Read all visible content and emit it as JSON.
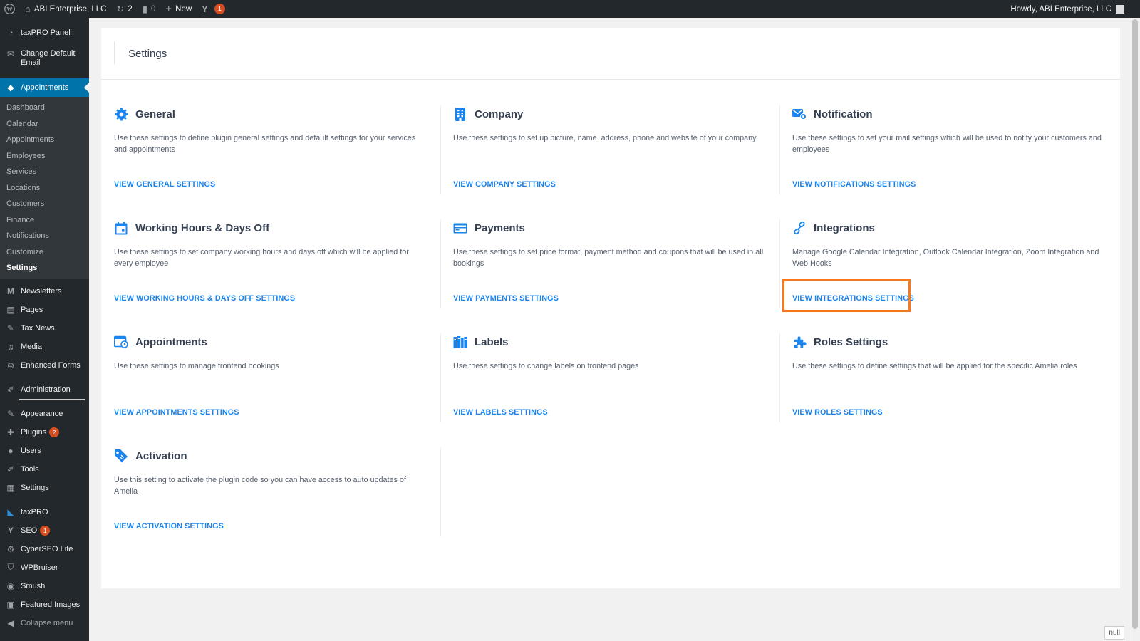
{
  "adminbar": {
    "site_name": "ABI Enterprise, LLC",
    "updates_count": "2",
    "comments_count": "0",
    "new_label": "New",
    "yoast_count": "1",
    "howdy": "Howdy, ABI Enterprise, LLC"
  },
  "sidebar": {
    "top_items": [
      {
        "label": "taxPRO Panel",
        "icon": "gauge-icon"
      },
      {
        "label": "Change Default Email",
        "icon": "mail-icon"
      }
    ],
    "current": {
      "label": "Appointments",
      "icon": "amelia-icon"
    },
    "submenu": [
      "Dashboard",
      "Calendar",
      "Appointments",
      "Employees",
      "Services",
      "Locations",
      "Customers",
      "Finance",
      "Notifications",
      "Customize",
      "Settings"
    ],
    "active_submenu": "Settings",
    "items": [
      {
        "label": "Newsletters",
        "icon": "newsletter-icon"
      },
      {
        "label": "Pages",
        "icon": "pages-icon"
      },
      {
        "label": "Tax News",
        "icon": "pin-icon"
      },
      {
        "label": "Media",
        "icon": "media-icon"
      },
      {
        "label": "Enhanced Forms",
        "icon": "forms-icon"
      },
      {
        "label": "Administration",
        "icon": "wrench-icon"
      },
      {
        "label": "Appearance",
        "icon": "brush-icon"
      },
      {
        "label": "Plugins",
        "icon": "plugin-icon",
        "badge": "2"
      },
      {
        "label": "Users",
        "icon": "users-icon"
      },
      {
        "label": "Tools",
        "icon": "tools-icon"
      },
      {
        "label": "Settings",
        "icon": "settings-icon"
      },
      {
        "label": "taxPRO",
        "icon": "taxpro-icon"
      },
      {
        "label": "SEO",
        "icon": "yoast-icon",
        "badge": "1"
      },
      {
        "label": "CyberSEO Lite",
        "icon": "gear-icon"
      },
      {
        "label": "WPBruiser",
        "icon": "shield-icon"
      },
      {
        "label": "Smush",
        "icon": "smush-icon"
      },
      {
        "label": "Featured Images",
        "icon": "images-icon"
      }
    ],
    "collapse_label": "Collapse menu"
  },
  "page": {
    "title": "Settings"
  },
  "cards": [
    {
      "title": "General",
      "icon": "gear-icon",
      "description": "Use these settings to define plugin general settings and default settings for your services and appointments",
      "link": "VIEW GENERAL SETTINGS"
    },
    {
      "title": "Company",
      "icon": "building-icon",
      "description": "Use these settings to set up picture, name, address, phone and website of your company",
      "link": "VIEW COMPANY SETTINGS"
    },
    {
      "title": "Notification",
      "icon": "mail-gear-icon",
      "description": "Use these settings to set your mail settings which will be used to notify your customers and employees",
      "link": "VIEW NOTIFICATIONS SETTINGS"
    },
    {
      "title": "Working Hours & Days Off",
      "icon": "calendar-icon",
      "description": "Use these settings to set company working hours and days off which will be applied for every employee",
      "link": "VIEW WORKING HOURS & DAYS OFF SETTINGS"
    },
    {
      "title": "Payments",
      "icon": "credit-card-icon",
      "description": "Use these settings to set price format, payment method and coupons that will be used in all bookings",
      "link": "VIEW PAYMENTS SETTINGS"
    },
    {
      "title": "Integrations",
      "icon": "link-icon",
      "description": "Manage Google Calendar Integration, Outlook Calendar Integration, Zoom Integration and Web Hooks",
      "link": "VIEW INTEGRATIONS SETTINGS"
    },
    {
      "title": "Appointments",
      "icon": "calendar-clock-icon",
      "description": "Use these settings to manage frontend bookings",
      "link": "VIEW APPOINTMENTS SETTINGS"
    },
    {
      "title": "Labels",
      "icon": "labels-icon",
      "description": "Use these settings to change labels on frontend pages",
      "link": "VIEW LABELS SETTINGS"
    },
    {
      "title": "Roles Settings",
      "icon": "puzzle-icon",
      "description": "Use these settings to define settings that will be applied for the specific Amelia roles",
      "link": "VIEW ROLES SETTINGS"
    },
    {
      "title": "Activation",
      "icon": "tag-icon",
      "description": "Use this setting to activate the plugin code so you can have access to auto updates of Amelia",
      "link": "VIEW ACTIVATION SETTINGS"
    }
  ],
  "highlight_color": "#f47920",
  "link_color": "#1a84ee",
  "accent": "#0073aa",
  "footer_box": "null"
}
